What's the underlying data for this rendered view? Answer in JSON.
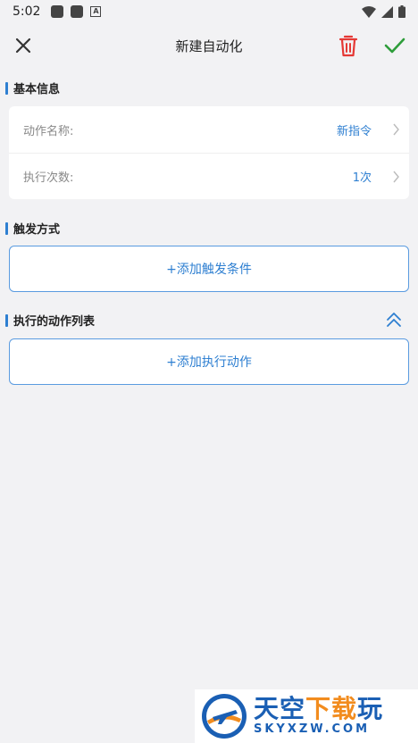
{
  "status_bar": {
    "time": "5:02"
  },
  "toolbar": {
    "title": "新建自动化"
  },
  "basic_info": {
    "heading": "基本信息",
    "rows": [
      {
        "label": "动作名称:",
        "value": "新指令"
      },
      {
        "label": "执行次数:",
        "value": "1次"
      }
    ]
  },
  "trigger": {
    "heading": "触发方式",
    "add_label": "+添加触发条件"
  },
  "actions": {
    "heading": "执行的动作列表",
    "add_label": "+添加执行动作"
  },
  "colors": {
    "accent": "#2e7fd1",
    "delete": "#e53935",
    "confirm": "#2e9d3a",
    "background": "#f2f2f4"
  }
}
